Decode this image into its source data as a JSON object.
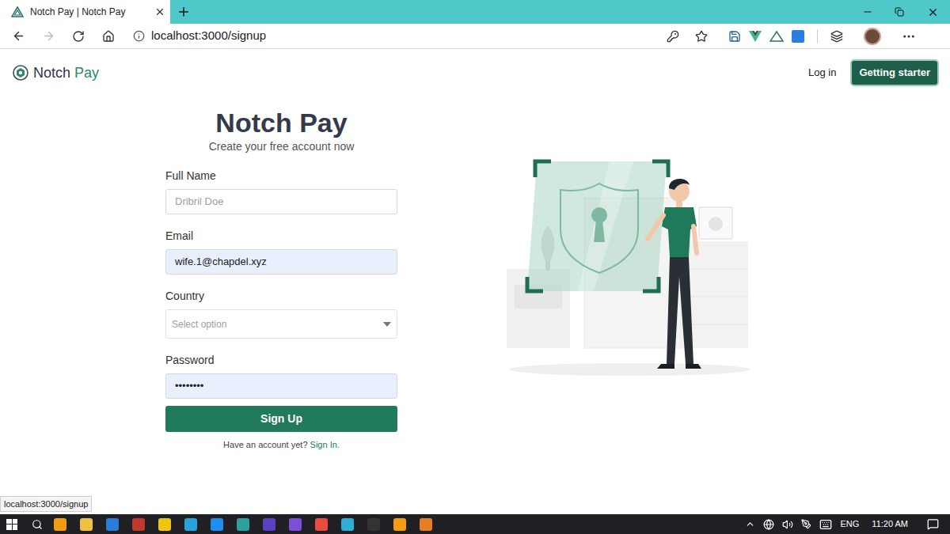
{
  "browser": {
    "tab": {
      "title": "Notch Pay | Notch Pay",
      "selected": true
    },
    "address": "localhost:3000/signup"
  },
  "nav": {
    "brand": {
      "first": "Notch",
      "second": "Pay"
    },
    "links": [
      {
        "label": "Log in",
        "kind": "link"
      },
      {
        "label": "Getting starter",
        "kind": "button"
      }
    ]
  },
  "form": {
    "title": "Notch Pay",
    "subtitle": "Create your free account now",
    "fields": [
      {
        "label": "Full Name",
        "kind": "text",
        "placeholder": "Dribril Doe",
        "autofill": false
      },
      {
        "label": "Email",
        "kind": "text",
        "value": "wife.1@chapdel.xyz",
        "autofill": true
      },
      {
        "label": "Country",
        "kind": "select",
        "placeholder": "Select option",
        "autofill": false
      },
      {
        "label": "Password",
        "kind": "password",
        "value": "••••••••",
        "autofill": true
      }
    ],
    "submit": "Sign Up",
    "footer": {
      "text": "Have an account yet?",
      "link": "Sign In."
    }
  },
  "status_url": "localhost:3000/signup",
  "taskbar": {
    "language": "ENG",
    "time": "11:20 AM"
  }
}
